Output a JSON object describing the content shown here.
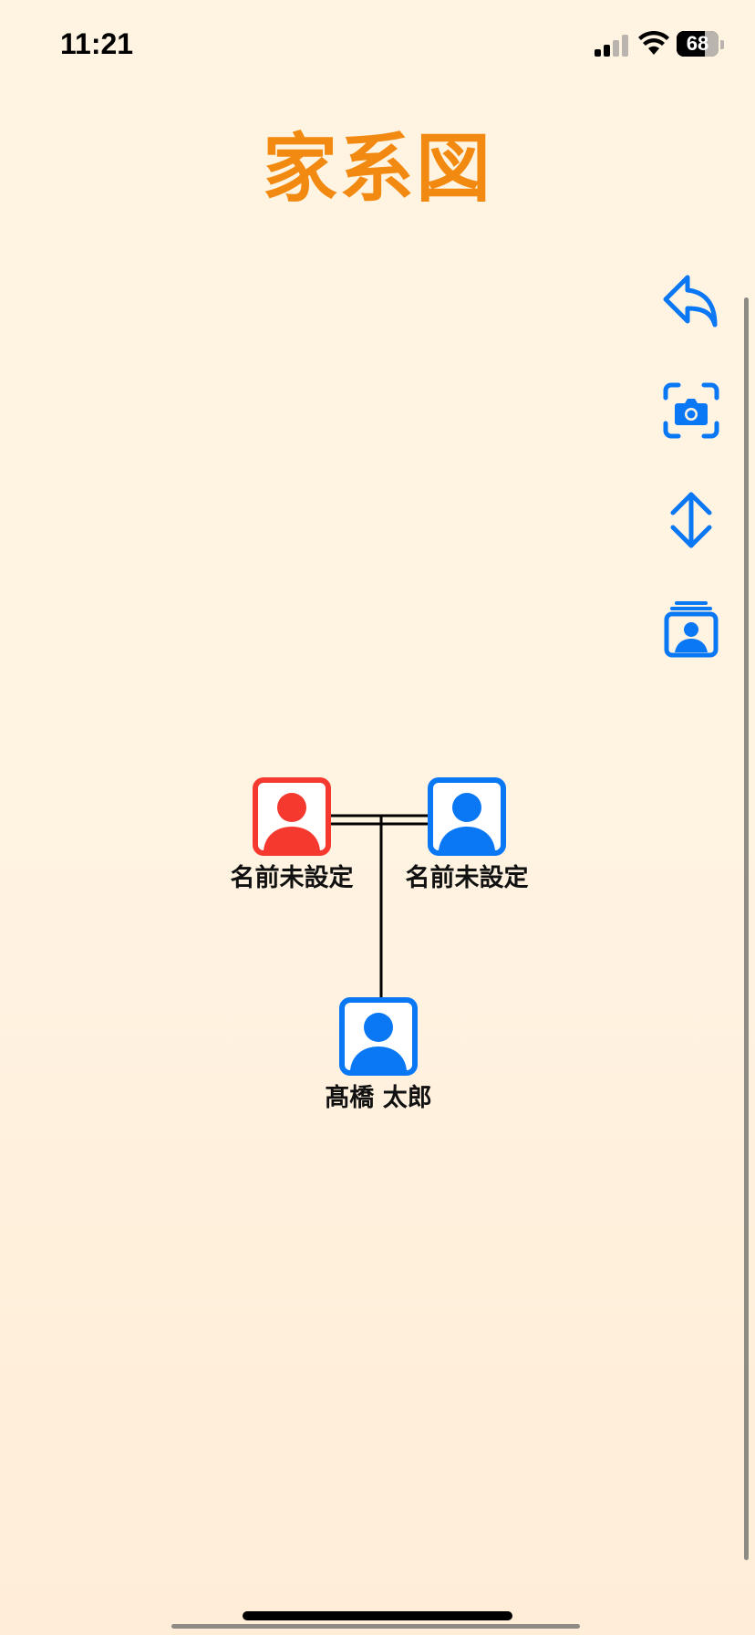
{
  "status_bar": {
    "time": "11:21",
    "battery_percent": "68",
    "battery_level": 0.68,
    "signal_bars_active": 2,
    "signal_bars_total": 4
  },
  "header": {
    "title": "家系図"
  },
  "toolbar": {
    "buttons": [
      {
        "icon": "reply-arrow-icon"
      },
      {
        "icon": "camera-viewfinder-icon"
      },
      {
        "icon": "vertical-arrows-icon"
      },
      {
        "icon": "person-stack-icon"
      }
    ]
  },
  "tree": {
    "people": [
      {
        "name": "名前未設定",
        "role": "mother",
        "color": "#f5392f"
      },
      {
        "name": "名前未設定",
        "role": "father",
        "color": "#0a78f5"
      },
      {
        "name": "髙橋 太郎",
        "role": "child",
        "color": "#0a78f5"
      }
    ]
  },
  "colors": {
    "accent": "#0a78f5",
    "title": "#f28a12",
    "female": "#f5392f",
    "male": "#0a78f5",
    "background": "#fff4e2"
  }
}
